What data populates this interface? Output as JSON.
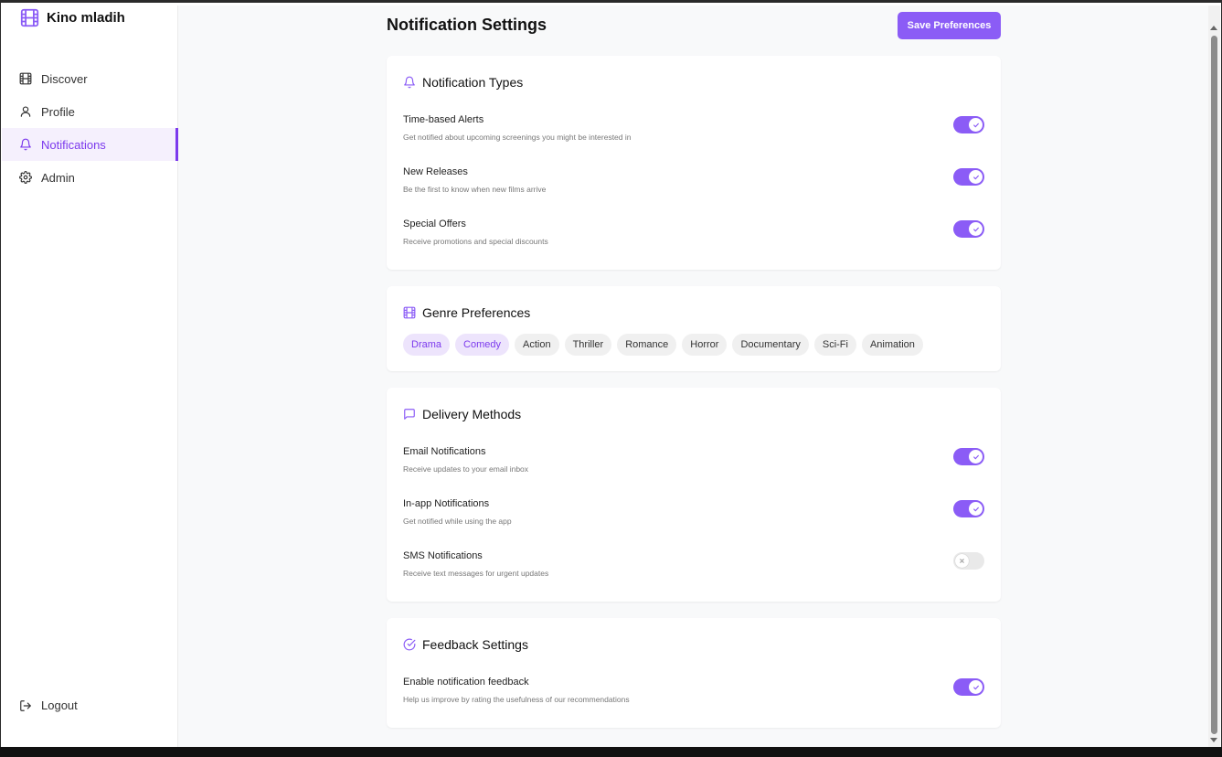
{
  "sidebar": {
    "brand": "Kino mladih",
    "items": [
      {
        "label": "Discover",
        "icon": "film-icon"
      },
      {
        "label": "Profile",
        "icon": "user-icon"
      },
      {
        "label": "Notifications",
        "icon": "bell-icon"
      },
      {
        "label": "Admin",
        "icon": "gear-icon"
      }
    ],
    "active": "Notifications",
    "logout": "Logout"
  },
  "header": {
    "title": "Notification Settings",
    "save_label": "Save Preferences"
  },
  "notification_types": {
    "title": "Notification Types",
    "items": [
      {
        "label": "Time-based Alerts",
        "desc": "Get notified about upcoming screenings you might be interested in",
        "on": true
      },
      {
        "label": "New Releases",
        "desc": "Be the first to know when new films arrive",
        "on": true
      },
      {
        "label": "Special Offers",
        "desc": "Receive promotions and special discounts",
        "on": true
      }
    ]
  },
  "genres": {
    "title": "Genre Preferences",
    "items": [
      {
        "label": "Drama",
        "selected": true
      },
      {
        "label": "Comedy",
        "selected": true
      },
      {
        "label": "Action",
        "selected": false
      },
      {
        "label": "Thriller",
        "selected": false
      },
      {
        "label": "Romance",
        "selected": false
      },
      {
        "label": "Horror",
        "selected": false
      },
      {
        "label": "Documentary",
        "selected": false
      },
      {
        "label": "Sci-Fi",
        "selected": false
      },
      {
        "label": "Animation",
        "selected": false
      }
    ]
  },
  "delivery": {
    "title": "Delivery Methods",
    "items": [
      {
        "label": "Email Notifications",
        "desc": "Receive updates to your email inbox",
        "on": true
      },
      {
        "label": "In-app Notifications",
        "desc": "Get notified while using the app",
        "on": true
      },
      {
        "label": "SMS Notifications",
        "desc": "Receive text messages for urgent updates",
        "on": false
      }
    ]
  },
  "feedback": {
    "title": "Feedback Settings",
    "items": [
      {
        "label": "Enable notification feedback",
        "desc": "Help us improve by rating the usefulness of our recommendations",
        "on": true
      }
    ]
  },
  "colors": {
    "accent": "#8b5cf6",
    "accent_text": "#7c3aed",
    "chip_selected_bg": "#ede4fc",
    "toggle_off": "#e9e9e9"
  }
}
